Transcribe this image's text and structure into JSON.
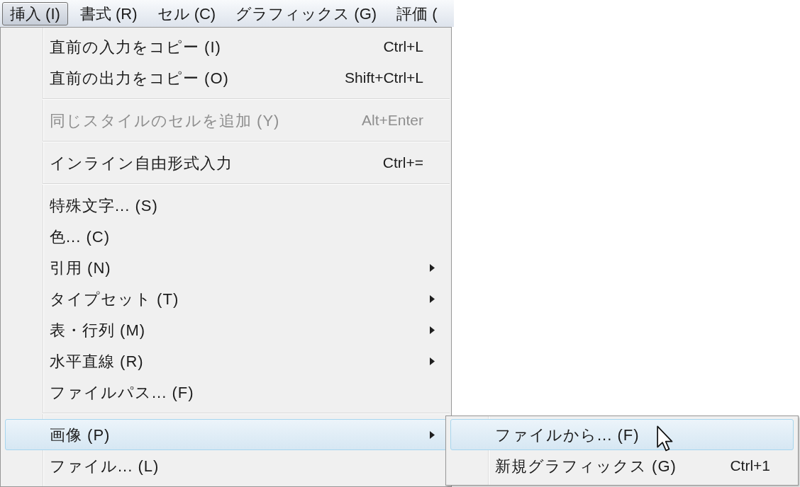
{
  "menubar": {
    "menus": [
      {
        "label": "挿入 (I)",
        "selected": true
      },
      {
        "label": "書式 (R)",
        "selected": false
      },
      {
        "label": "セル (C)",
        "selected": false
      },
      {
        "label": "グラフィックス (G)",
        "selected": false
      },
      {
        "label": "評価 (",
        "selected": false
      }
    ]
  },
  "menu": {
    "items": [
      {
        "kind": "item",
        "label": "直前の入力をコピー (I)",
        "shortcut": "Ctrl+L",
        "disabled": false,
        "has_submenu": false,
        "selected": false
      },
      {
        "kind": "item",
        "label": "直前の出力をコピー (O)",
        "shortcut": "Shift+Ctrl+L",
        "disabled": false,
        "has_submenu": false,
        "selected": false
      },
      {
        "kind": "separator"
      },
      {
        "kind": "item",
        "label": "同じスタイルのセルを追加 (Y)",
        "shortcut": "Alt+Enter",
        "disabled": true,
        "has_submenu": false,
        "selected": false
      },
      {
        "kind": "separator"
      },
      {
        "kind": "item",
        "label": "インライン自由形式入力",
        "shortcut": "Ctrl+=",
        "disabled": false,
        "has_submenu": false,
        "selected": false
      },
      {
        "kind": "separator"
      },
      {
        "kind": "item",
        "label": "特殊文字... (S)",
        "disabled": false,
        "has_submenu": false,
        "selected": false
      },
      {
        "kind": "item",
        "label": "色... (C)",
        "disabled": false,
        "has_submenu": false,
        "selected": false
      },
      {
        "kind": "item",
        "label": "引用 (N)",
        "disabled": false,
        "has_submenu": true,
        "selected": false
      },
      {
        "kind": "item",
        "label": "タイプセット (T)",
        "disabled": false,
        "has_submenu": true,
        "selected": false
      },
      {
        "kind": "item",
        "label": "表・行列 (M)",
        "disabled": false,
        "has_submenu": true,
        "selected": false
      },
      {
        "kind": "item",
        "label": "水平直線 (R)",
        "disabled": false,
        "has_submenu": true,
        "selected": false
      },
      {
        "kind": "item",
        "label": "ファイルパス... (F)",
        "disabled": false,
        "has_submenu": false,
        "selected": false
      },
      {
        "kind": "separator"
      },
      {
        "kind": "item",
        "label": "画像 (P)",
        "disabled": false,
        "has_submenu": true,
        "selected": true
      },
      {
        "kind": "item",
        "label": "ファイル... (L)",
        "disabled": false,
        "has_submenu": false,
        "selected": false
      }
    ]
  },
  "submenu": {
    "items": [
      {
        "kind": "item",
        "label": "ファイルから... (F)",
        "disabled": false,
        "has_submenu": false,
        "selected": true
      },
      {
        "kind": "item",
        "label": "新規グラフィックス (G)",
        "shortcut": "Ctrl+1",
        "disabled": false,
        "has_submenu": false,
        "selected": false
      }
    ]
  }
}
